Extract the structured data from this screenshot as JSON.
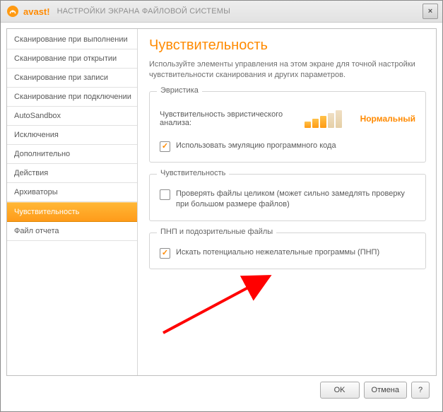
{
  "titlebar": {
    "brand": "avast",
    "brand_suffix": "!",
    "subtitle": "НАСТРОЙКИ ЭКРАНА ФАЙЛОВОЙ СИСТЕМЫ",
    "close": "×"
  },
  "sidebar": {
    "items": [
      {
        "label": "Сканирование при выполнении"
      },
      {
        "label": "Сканирование при открытии"
      },
      {
        "label": "Сканирование при записи"
      },
      {
        "label": "Сканирование при подключении"
      },
      {
        "label": "AutoSandbox"
      },
      {
        "label": "Исключения"
      },
      {
        "label": "Дополнительно"
      },
      {
        "label": "Действия"
      },
      {
        "label": "Архиваторы"
      },
      {
        "label": "Чувствительность"
      },
      {
        "label": "Файл отчета"
      }
    ],
    "active_index": 9
  },
  "page": {
    "title": "Чувствительность",
    "desc": "Используйте элементы управления на этом экране для точной настройки чувствительности сканирования и других параметров."
  },
  "group_heuristics": {
    "legend": "Эвристика",
    "row_label": "Чувствительность эвристического анализа:",
    "level_label": "Нормальный",
    "level_bars_active": 3,
    "level_bars_total": 5,
    "chk_emulation": {
      "checked": true,
      "label": "Использовать эмуляцию программного кода"
    }
  },
  "group_sensitivity": {
    "legend": "Чувствительность",
    "chk_whole": {
      "checked": false,
      "label": "Проверять файлы целиком (может сильно замедлять проверку при большом размере файлов)"
    }
  },
  "group_pup": {
    "legend": "ПНП и подозрительные файлы",
    "chk_pup": {
      "checked": true,
      "label": "Искать потенциально нежелательные программы (ПНП)"
    }
  },
  "footer": {
    "ok": "OK",
    "cancel": "Отмена",
    "help": "?"
  }
}
